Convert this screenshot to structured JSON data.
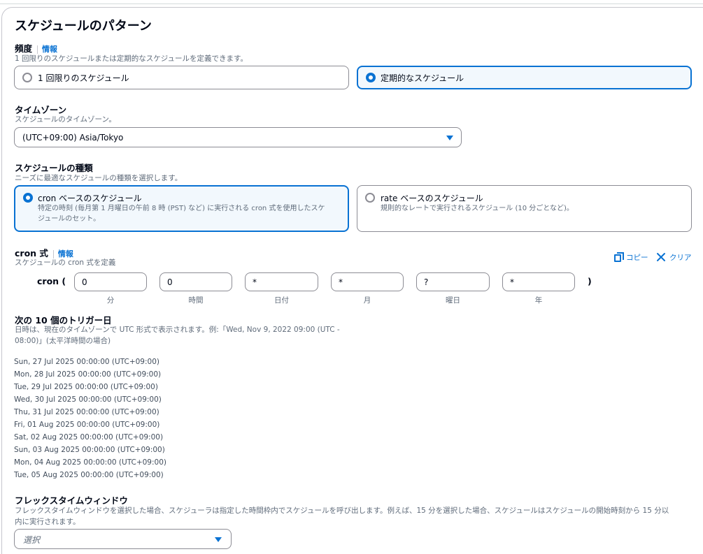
{
  "page_title": "スケジュールのパターン",
  "frequency": {
    "label": "頻度",
    "info": "情報",
    "description": "1 回限りのスケジュールまたは定期的なスケジュールを定義できます。",
    "options": [
      {
        "label": "1 回限りのスケジュール",
        "selected": false
      },
      {
        "label": "定期的なスケジュール",
        "selected": true
      }
    ]
  },
  "timezone": {
    "label": "タイムゾーン",
    "description": "スケジュールのタイムゾーン。",
    "value": "(UTC+09:00) Asia/Tokyo"
  },
  "schedule_type": {
    "label": "スケジュールの種類",
    "description": "ニーズに最適なスケジュールの種類を選択します。",
    "options": [
      {
        "title": "cron ベースのスケジュール",
        "desc_line1": "特定の時刻 (毎月第 1 月曜日の午前 8 時 (PST) など) に実行される cron 式を使用したスケ",
        "desc_line2": "ジュールのセット。",
        "selected": true
      },
      {
        "title": "rate ベースのスケジュール",
        "desc_line1": "規則的なレートで実行されるスケジュール (10 分ごとなど)。",
        "desc_line2": "",
        "selected": false
      }
    ]
  },
  "cron": {
    "label": "cron 式",
    "info": "情報",
    "description": "スケジュールの cron 式を定義",
    "copy_label": "コピー",
    "clear_label": "クリア",
    "prefix": "cron (",
    "suffix": ")",
    "fields": [
      {
        "value": "0",
        "label": "分"
      },
      {
        "value": "0",
        "label": "時間"
      },
      {
        "value": "*",
        "label": "日付"
      },
      {
        "value": "*",
        "label": "月"
      },
      {
        "value": "?",
        "label": "曜日"
      },
      {
        "value": "*",
        "label": "年"
      }
    ]
  },
  "triggers": {
    "label": "次の 10 個のトリガー日",
    "desc_line1": "日時は、現在のタイムゾーンで UTC 形式で表示されます。例:「Wed, Nov 9, 2022 09:00 (UTC -",
    "desc_line2": "08:00)」(太平洋時間の場合)",
    "dates": [
      "Sun, 27 Jul 2025 00:00:00 (UTC+09:00)",
      "Mon, 28 Jul 2025 00:00:00 (UTC+09:00)",
      "Tue, 29 Jul 2025 00:00:00 (UTC+09:00)",
      "Wed, 30 Jul 2025 00:00:00 (UTC+09:00)",
      "Thu, 31 Jul 2025 00:00:00 (UTC+09:00)",
      "Fri, 01 Aug 2025 00:00:00 (UTC+09:00)",
      "Sat, 02 Aug 2025 00:00:00 (UTC+09:00)",
      "Sun, 03 Aug 2025 00:00:00 (UTC+09:00)",
      "Mon, 04 Aug 2025 00:00:00 (UTC+09:00)",
      "Tue, 05 Aug 2025 00:00:00 (UTC+09:00)"
    ]
  },
  "flex_window": {
    "label": "フレックスタイムウィンドウ",
    "desc_line1": "フレックスタイムウィンドウを選択した場合、スケジューラは指定した時間枠内でスケジュールを呼び出します。例えば、15 分を選択した場合、スケジュールはスケジュールの開始時刻から 15 分以",
    "desc_line2": "内に実行されます。",
    "placeholder": "選択"
  },
  "colors": {
    "accent": "#0972d3",
    "text": "#000716",
    "muted": "#5f6b7a",
    "border": "#8c8c94",
    "selected_bg": "#f2f8fd"
  }
}
